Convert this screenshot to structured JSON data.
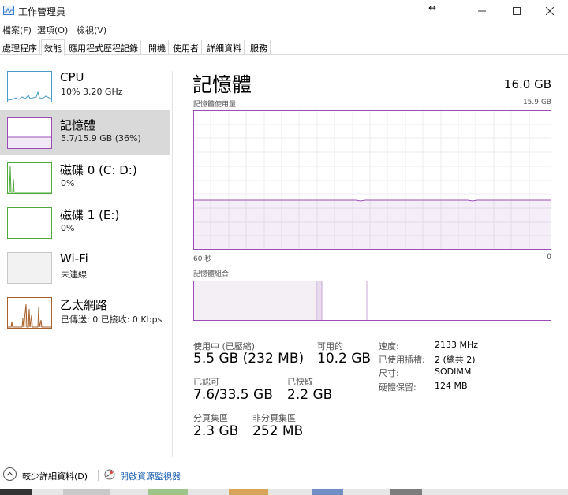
{
  "window": {
    "title": "工作管理員",
    "resize_glyph": "↔"
  },
  "menu": {
    "items": [
      "檔案(F)",
      "選項(O)",
      "檢視(V)"
    ]
  },
  "tabs": {
    "items": [
      "處理程序",
      "效能",
      "應用程式歷程記錄",
      "開機",
      "使用者",
      "詳細資料",
      "服務"
    ],
    "active": "效能"
  },
  "sidebar": {
    "items": [
      {
        "name": "CPU",
        "sub": "10%  3.20 GHz",
        "thumb_color": "#4a9bc7"
      },
      {
        "name": "記憶體",
        "sub": "5.7/15.9 GB (36%)",
        "thumb_color": "#9b4db7",
        "selected": true
      },
      {
        "name": "磁碟 0 (C: D:)",
        "sub": "0%",
        "thumb_color": "#4daa3a"
      },
      {
        "name": "磁碟 1 (E:)",
        "sub": "0%",
        "thumb_color": "#4daa3a"
      },
      {
        "name": "Wi-Fi",
        "sub": "未連線",
        "thumb_color": "#b0b0b0"
      },
      {
        "name": "乙太網路",
        "sub": "已傳送: 0  已接收: 0 Kbps",
        "thumb_color": "#a7602b"
      }
    ]
  },
  "memory": {
    "title": "記憶體",
    "total": "16.0 GB",
    "usage_label": "記憶體使用量",
    "usage_max": "15.9 GB",
    "axis_left": "60 秒",
    "axis_right": "0",
    "composition_label": "記憶體組合",
    "accent_color": "#9b4db7",
    "usage_fraction": 0.36,
    "stats": {
      "in_use_label": "使用中 (已壓縮)",
      "in_use_value": "5.5 GB (232 MB)",
      "available_label": "可用的",
      "available_value": "10.2 GB",
      "committed_label": "已認可",
      "committed_value": "7.6/33.5 GB",
      "cached_label": "已快取",
      "cached_value": "2.2 GB",
      "paged_label": "分頁集區",
      "paged_value": "2.3 GB",
      "nonpaged_label": "非分頁集區",
      "nonpaged_value": "252 MB"
    },
    "details": [
      {
        "label": "速度:",
        "value": "2133 MHz"
      },
      {
        "label": "已使用插槽:",
        "value": "2 (總共 2)"
      },
      {
        "label": "尺寸:",
        "value": "SODIMM"
      },
      {
        "label": "硬體保留:",
        "value": "124 MB"
      }
    ]
  },
  "footer": {
    "fewer_details": "較少詳細資料(D)",
    "resource_monitor": "開啟資源監視器"
  }
}
